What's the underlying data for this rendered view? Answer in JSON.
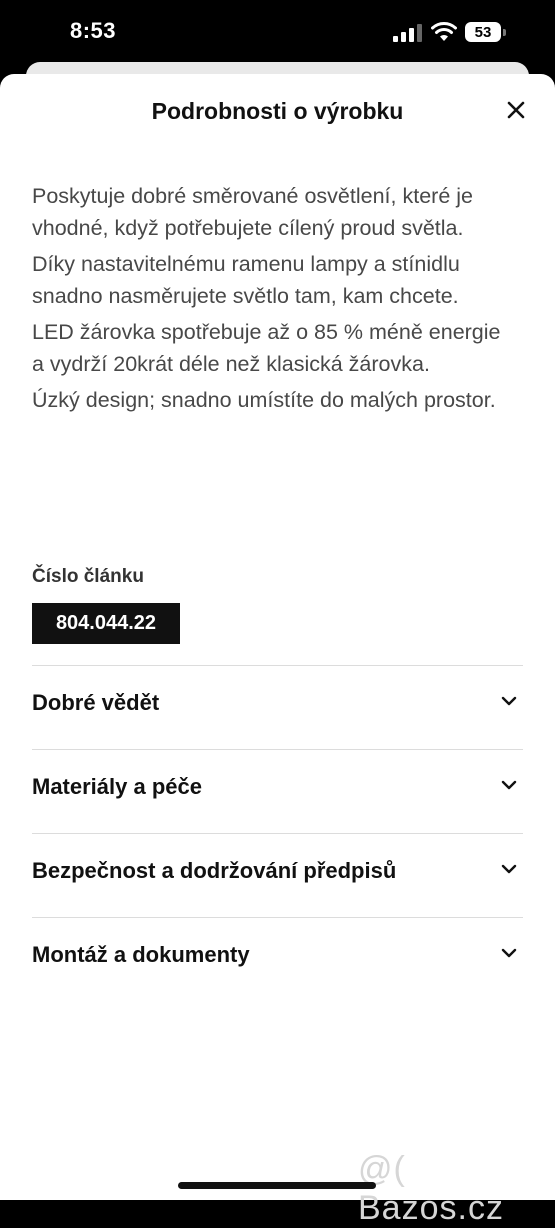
{
  "status_bar": {
    "time": "8:53",
    "battery": "53",
    "icons": [
      "signal-icon",
      "wifi-icon",
      "battery-icon"
    ]
  },
  "sheet": {
    "title": "Podrobnosti o výrobku",
    "close_icon": "close-icon",
    "description": [
      "Poskytuje dobré směrované osvětlení, které je vhodné, když potřebujete cílený proud světla.",
      "Díky nastavitelnému ramenu lampy a stínidlu snadno nasměrujete světlo tam, kam chcete.",
      "LED žárovka spotřebuje až o 85 % méně energie a vydrží 20krát déle než klasická žárovka.",
      "Úzký design; snadno umístíte do malých prostor."
    ],
    "article_label": "Číslo článku",
    "article_number": "804.044.22",
    "accordion": [
      {
        "label": "Dobré vědět"
      },
      {
        "label": "Materiály a péče"
      },
      {
        "label": "Bezpečnost a dodržování předpisů"
      },
      {
        "label": "Montáž a dokumenty"
      }
    ]
  },
  "watermark": "@( Bazos.cz",
  "colors": {
    "status_bar_bg": "#000000",
    "sheet_bg": "#ffffff",
    "article_badge_bg": "#111111",
    "divider": "#dcdcdc"
  }
}
